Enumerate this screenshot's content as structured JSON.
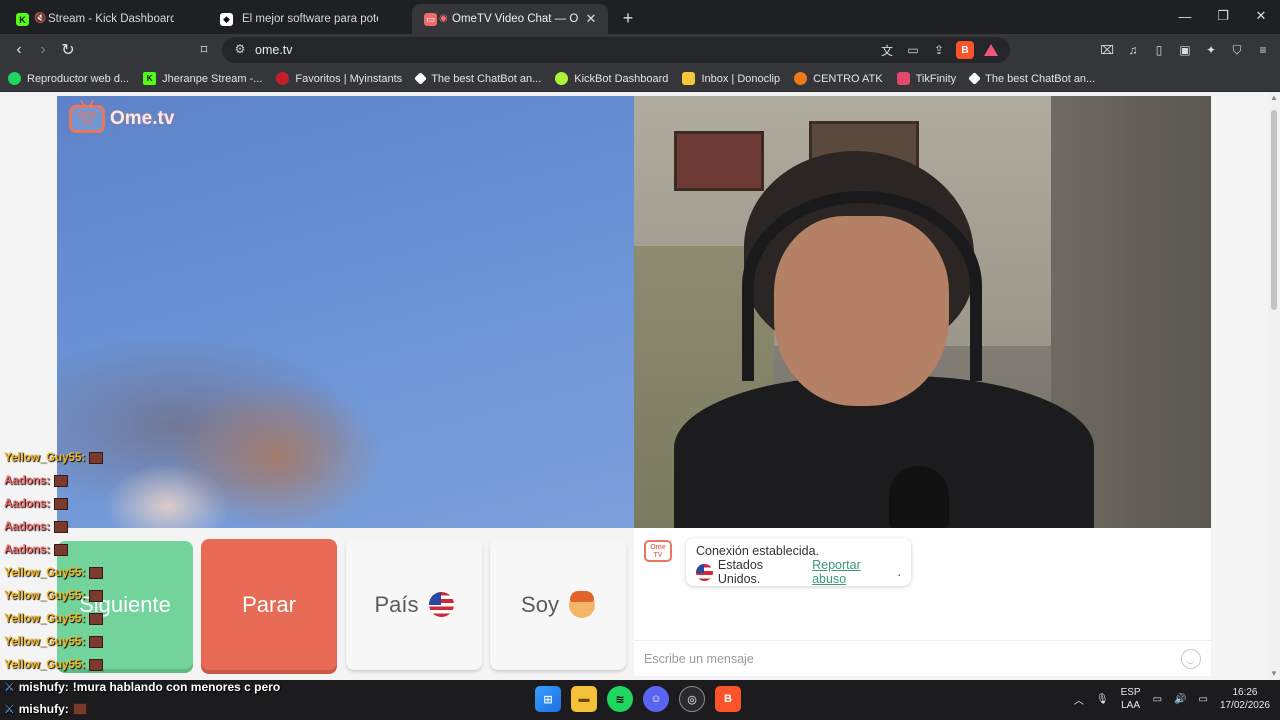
{
  "browser": {
    "tabs": [
      {
        "label": "Stream - Kick Dashboard",
        "active": false
      },
      {
        "label": "El mejor software para potenciar tu st",
        "active": false
      },
      {
        "label": "OmeTV Video Chat — Omegl",
        "active": true
      }
    ],
    "url": "ome.tv",
    "bookmarks": [
      "Reproductor web d...",
      "Jheranpe Stream -...",
      "Favoritos | Myinstants",
      "The best ChatBot an...",
      "KickBot Dashboard",
      "Inbox | Donoclip",
      "CENTRO ATK",
      "TikFinity",
      "The best ChatBot an..."
    ]
  },
  "page": {
    "logo_text": "Ome.tv",
    "buttons": {
      "next": "Siguiente",
      "stop": "Parar",
      "country": "País",
      "gender": "Soy"
    },
    "chat": {
      "status": "Conexión establecida.",
      "country": "Estados Unidos.",
      "report": "Reportar abuso",
      "report_suffix": ".",
      "placeholder": "Escribe un mensaje"
    }
  },
  "overlay_chat": [
    {
      "user": "Yellow_Guy55:",
      "color": "#f2b624"
    },
    {
      "user": "Aadons:",
      "color": "#f06a6a"
    },
    {
      "user": "Aadons:",
      "color": "#f06a6a"
    },
    {
      "user": "Aadons:",
      "color": "#f06a6a"
    },
    {
      "user": "Aadons:",
      "color": "#f06a6a"
    },
    {
      "user": "Yellow_Guy55:",
      "color": "#f2b624"
    },
    {
      "user": "Yellow_Guy55:",
      "color": "#f2b624"
    },
    {
      "user": "Yellow_Guy55:",
      "color": "#f2b624"
    },
    {
      "user": "Yellow_Guy55:",
      "color": "#f2b624"
    },
    {
      "user": "Yellow_Guy55:",
      "color": "#f2b624"
    }
  ],
  "bottom_chat": [
    {
      "user": "mishufy:",
      "message": "!mura hablando con menores c pero"
    },
    {
      "user": "mishufy:",
      "message": ""
    }
  ],
  "taskbar": {
    "lang_line1": "ESP",
    "lang_line2": "LAA",
    "time": "16:26",
    "date": "17/02/2026"
  },
  "colors": {
    "next_button": "#73d49b",
    "stop_button": "#e86b56",
    "accent_logo": "#e9775e",
    "report_link": "#3a9a7a"
  }
}
